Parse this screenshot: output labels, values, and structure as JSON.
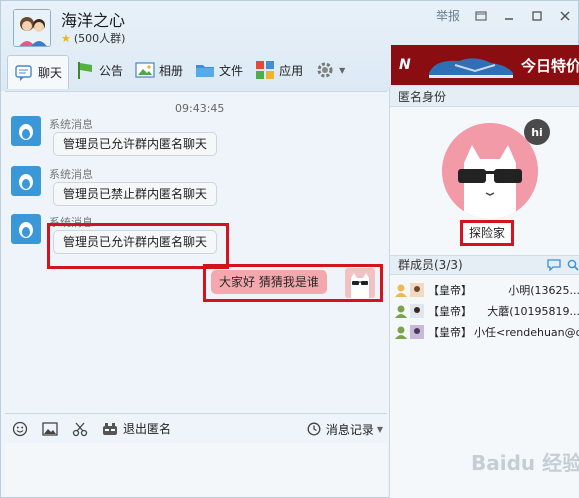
{
  "window": {
    "group_name": "海洋之心",
    "member_count": "(500人群)",
    "report_label": "举报"
  },
  "toolbar": {
    "items": [
      {
        "label": "聊天",
        "icon": "chat-icon"
      },
      {
        "label": "公告",
        "icon": "announcement-icon"
      },
      {
        "label": "相册",
        "icon": "album-icon"
      },
      {
        "label": "文件",
        "icon": "folder-icon"
      },
      {
        "label": "应用",
        "icon": "apps-icon"
      }
    ]
  },
  "chat": {
    "timestamp": "09:43:45",
    "messages": [
      {
        "sender": "系统消息",
        "text": "管理员已允许群内匿名聊天"
      },
      {
        "sender": "系统消息",
        "text": "管理员已禁止群内匿名聊天"
      },
      {
        "sender": "系统消息",
        "text": "管理员已允许群内匿名聊天"
      }
    ],
    "my_message": "大家好  猜猜我是谁"
  },
  "input_toolbar": {
    "quit_anon_label": "退出匿名",
    "history_label": "消息记录"
  },
  "ad": {
    "logo": "N",
    "text": "今日特价"
  },
  "right_panel": {
    "title": "匿名身份",
    "anon_name": "探险家",
    "hi_badge": "hi",
    "members_header": "群成员(3/3)",
    "members": [
      {
        "title": "【皇帝】",
        "name": "小明(13625..."
      },
      {
        "title": "【皇帝】",
        "name": "大蘑(10195819..."
      },
      {
        "title": "【皇帝】",
        "name": "小任<rendehuan@q..."
      }
    ]
  },
  "watermark": "Baidu 经验",
  "colors": {
    "accent_red": "#d3141e",
    "qq_blue": "#3a97d8",
    "my_bubble": "#f4a8ad"
  }
}
